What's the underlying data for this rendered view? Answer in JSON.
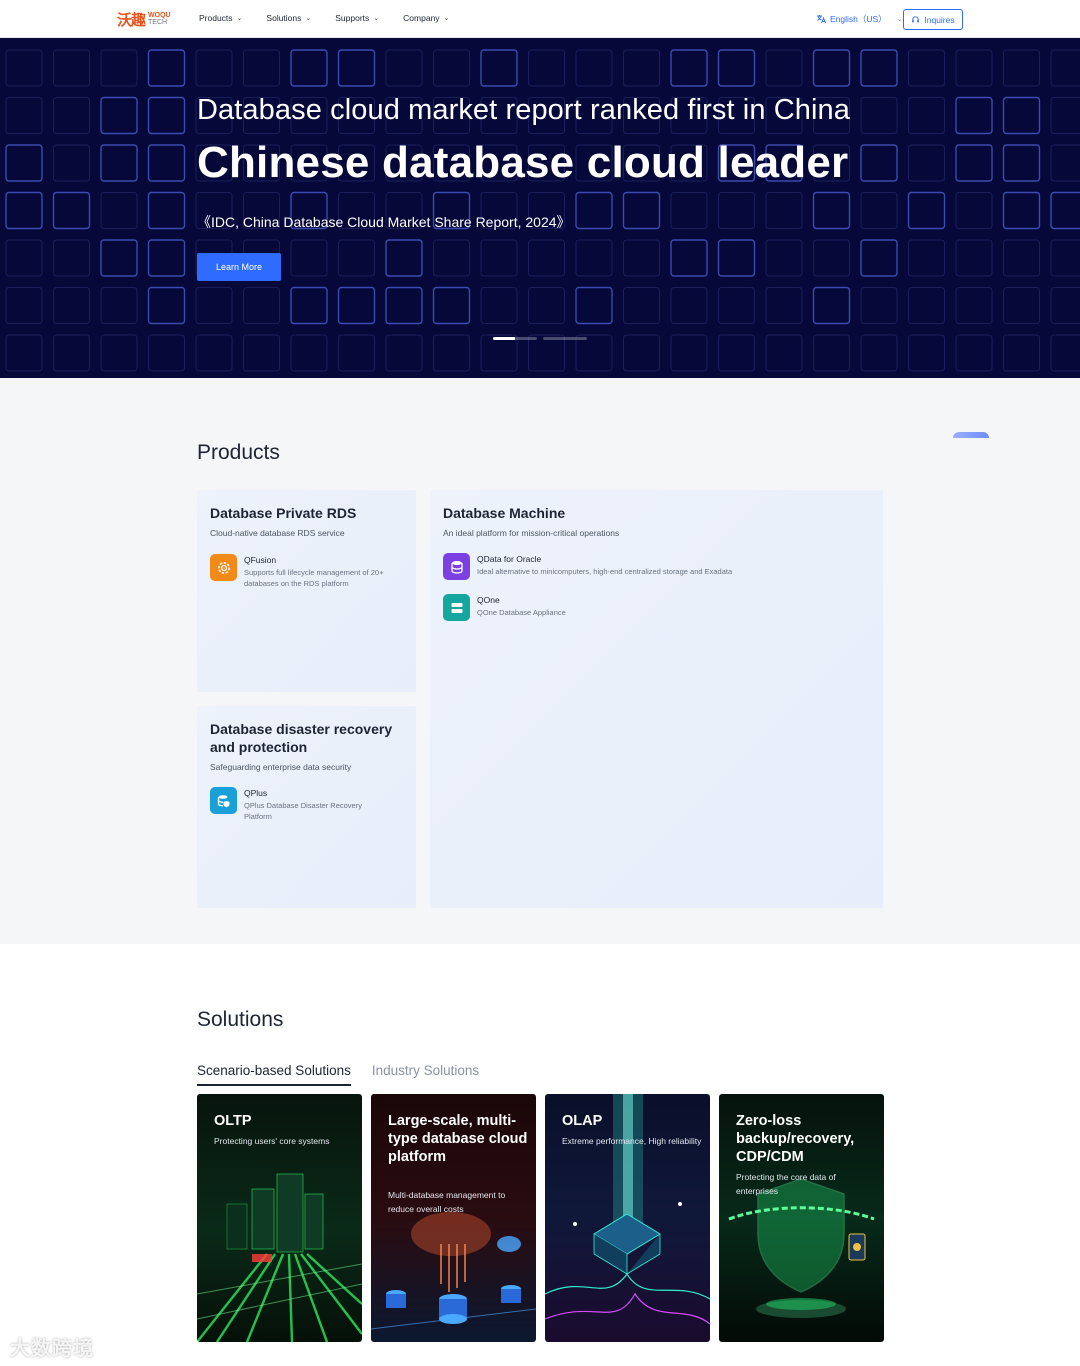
{
  "nav": {
    "logo_mark": "沃趣",
    "logo_line1": "WOQU",
    "logo_line2": "TECH",
    "menu": [
      {
        "label": "Products"
      },
      {
        "label": "Solutions"
      },
      {
        "label": "Supports"
      },
      {
        "label": "Company"
      }
    ],
    "language": "English（US）",
    "inquires": "Inquires"
  },
  "hero": {
    "headline": "Database cloud market report ranked first in China",
    "title": "Chinese database cloud leader",
    "source": "《IDC, China Database Cloud Market Share Report, 2024》",
    "cta": "Learn More",
    "slides": 2,
    "active_slide": 1
  },
  "products": {
    "title": "Products",
    "cards": [
      {
        "title": "Database Private RDS",
        "subtitle": "Cloud-native database RDS service",
        "items": [
          {
            "name": "QFusion",
            "desc": "Supports full lifecycle management of 20+ databases on the RDS platform",
            "icon": "gear-icon",
            "color": "#f28a1a"
          }
        ]
      },
      {
        "title": "Database Machine",
        "subtitle": "An ideal platform for mission-critical operations",
        "items": [
          {
            "name": "QData for Oracle",
            "desc": "Ideal alternative to minicomputers, high-end centralized storage and Exadata",
            "icon": "database-icon",
            "color": "#7b3fe4"
          },
          {
            "name": "QOne",
            "desc": "QOne Database Appliance",
            "icon": "server-icon",
            "color": "#16a6a0"
          }
        ]
      },
      {
        "title": "Database disaster recovery and protection",
        "subtitle": "Safeguarding enterprise data security",
        "items": [
          {
            "name": "QPlus",
            "desc": "QPlus Database Disaster Recovery Platform",
            "icon": "database-shield-icon",
            "color": "#1aa0d8"
          }
        ]
      }
    ]
  },
  "solutions": {
    "title": "Solutions",
    "tabs": [
      {
        "label": "Scenario-based Solutions",
        "active": true
      },
      {
        "label": "Industry Solutions",
        "active": false
      }
    ],
    "cards": [
      {
        "title": "OLTP",
        "desc": "Protecting users' core systems",
        "accent": "#2be05a"
      },
      {
        "title": "Large-scale, multi-type database cloud platform",
        "desc": "Multi-database management to reduce overall costs",
        "accent": "#ff6b3a"
      },
      {
        "title": "OLAP",
        "desc": "Extreme performance, High reliability",
        "accent": "#2ff0d0"
      },
      {
        "title": "Zero-loss backup/recovery, CDP/CDM",
        "desc": "Protecting the core data of enterprises",
        "accent": "#22d66a"
      }
    ]
  },
  "watermark": "大数跨境"
}
